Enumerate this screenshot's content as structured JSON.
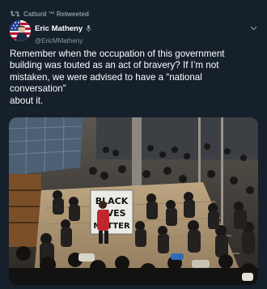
{
  "retweet": {
    "label": "Catturd ™ Retweeted",
    "icon": "retweet-icon"
  },
  "author": {
    "display_name": "Eric Matheny",
    "handle": "@EricMMatheny",
    "avatar_icon": "american-flag-avatar",
    "badge_icon": "microphone-icon"
  },
  "tweet": {
    "lines": [
      "Remember when the occupation of this government",
      "building was touted as an act of bravery? If I’m not",
      "mistaken, we were advised to have a “national",
      "conversation”",
      "about it."
    ]
  },
  "media": {
    "sign_lines": [
      "BLACK",
      "LIVES",
      "MATTER"
    ]
  },
  "colors": {
    "background": "#15202b",
    "text": "#ffffff",
    "secondary": "#8899a6"
  }
}
